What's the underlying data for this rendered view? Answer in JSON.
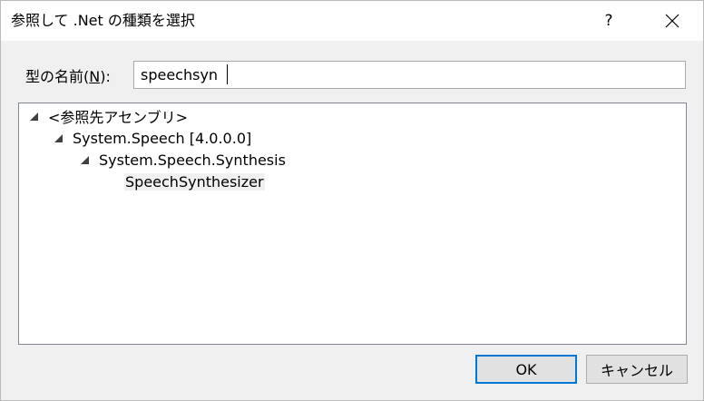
{
  "dialog": {
    "title": "参照して .Net の種類を選択",
    "help_glyph": "?",
    "close_glyph": "✕"
  },
  "name_field": {
    "label_prefix": "型の名前(",
    "label_access_key": "N",
    "label_suffix": "):",
    "value": "speechsyn"
  },
  "tree": {
    "nodes": [
      {
        "label": "<参照先アセンブリ>",
        "expanded": true
      },
      {
        "label": "System.Speech [4.0.0.0]",
        "expanded": true
      },
      {
        "label": "System.Speech.Synthesis",
        "expanded": true
      },
      {
        "label": "SpeechSynthesizer",
        "selected": true
      }
    ]
  },
  "buttons": {
    "ok": "OK",
    "cancel": "キャンセル"
  }
}
